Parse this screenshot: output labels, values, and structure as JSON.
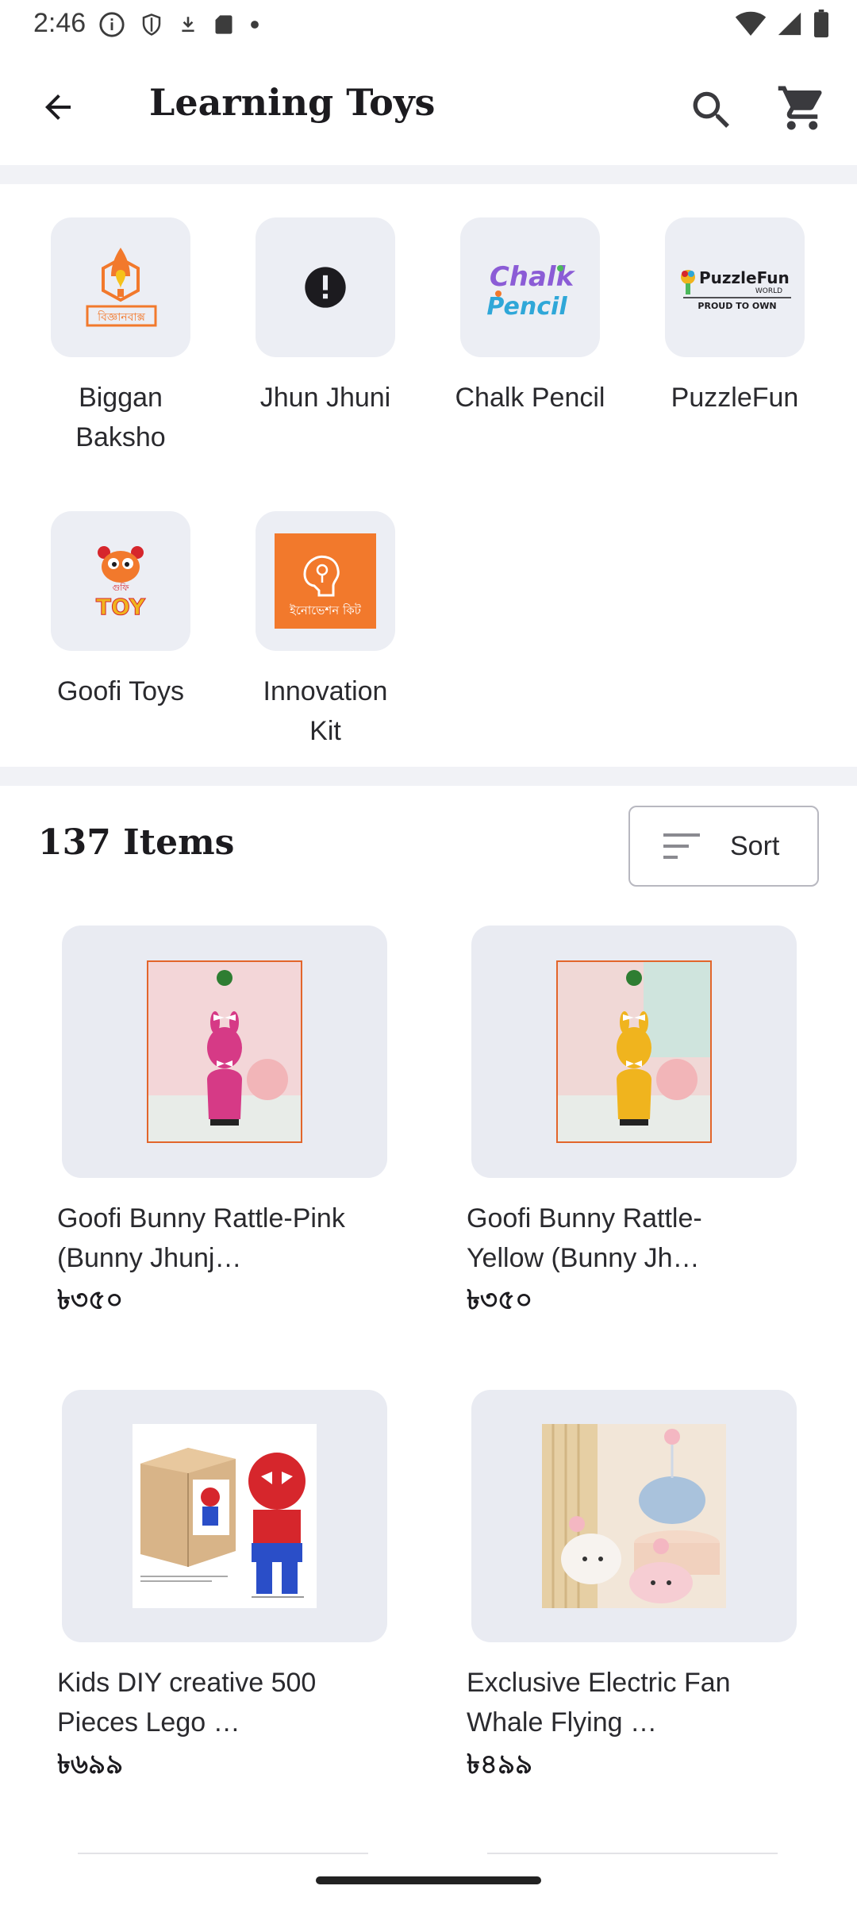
{
  "status_bar": {
    "time": "2:46",
    "left_icons": [
      "info-circle-icon",
      "shield-icon",
      "download-icon",
      "sd-card-icon",
      "dot-icon"
    ],
    "right_icons": [
      "wifi-icon",
      "signal-icon",
      "battery-icon"
    ]
  },
  "app_bar": {
    "title": "Learning Toys",
    "back_icon": "arrow-back-icon",
    "search_icon": "search-icon",
    "cart_icon": "cart-icon"
  },
  "brands": [
    {
      "name": "Biggan\nBaksho",
      "logo": "biggan-baksho-logo",
      "logo_text": "বিজ্ঞানবাক্স"
    },
    {
      "name": "Jhun Jhuni",
      "logo": "error-icon",
      "logo_text": ""
    },
    {
      "name": "Chalk Pencil",
      "logo": "chalk-pencil-logo",
      "logo_text": "Chalk Pencil"
    },
    {
      "name": "PuzzleFun",
      "logo": "puzzlefun-logo",
      "logo_text": "PuzzleFun",
      "logo_sub": "WORLD",
      "logo_tagline": "PROUD TO OWN"
    },
    {
      "name": "Goofi Toys",
      "logo": "goofi-toys-logo",
      "logo_text": "TOY",
      "logo_sub": "গুফি"
    },
    {
      "name": "Innovation\nKit",
      "logo": "innovation-kit-logo",
      "logo_text": "ইনোভেশন কিট"
    }
  ],
  "items": {
    "count_label": "137 Items",
    "sort_label": "Sort",
    "sort_icon": "sort-icon"
  },
  "products": [
    {
      "name": "Goofi Bunny Rattle-Pink (Bunny Jhunj…",
      "price": "৳৩৫০",
      "image": "pink-bunny-rattle",
      "color": "#d63a86"
    },
    {
      "name": "Goofi Bunny Rattle-Yellow (Bunny Jh…",
      "price": "৳৩৫০",
      "image": "yellow-bunny-rattle",
      "color": "#f0b41e"
    },
    {
      "name": "Kids DIY creative 500 Pieces Lego …",
      "price": "৳৬৯৯",
      "image": "spiderman-lego-set",
      "color": "#d6262c"
    },
    {
      "name": "Exclusive Electric Fan Whale Flying …",
      "price": "৳৪৯৯",
      "image": "whale-fan-toys",
      "color": "#a9c2dc"
    }
  ],
  "colors": {
    "tile_bg": "#eceef4",
    "divider": "#f1f2f6",
    "text": "#1c1b1f",
    "brand_orange": "#f2792c"
  }
}
